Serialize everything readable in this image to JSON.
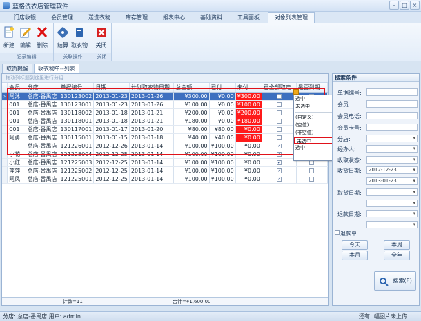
{
  "window": {
    "title": "蓝格洗衣店管理软件"
  },
  "menu_tabs": [
    "门店收银",
    "会员管理",
    "送洗衣物",
    "库存管理",
    "报表中心",
    "基础资料",
    "工具面板",
    "对象列表管理"
  ],
  "ribbon": {
    "groups": [
      {
        "title": "记录编辑",
        "buttons": [
          {
            "label": "新建",
            "icon": "new-doc-icon"
          },
          {
            "label": "编辑",
            "icon": "edit-icon"
          },
          {
            "label": "删除",
            "icon": "delete-x-icon"
          }
        ]
      },
      {
        "title": "关联操作",
        "buttons": [
          {
            "label": "结算",
            "icon": "settle-icon"
          },
          {
            "label": "取衣物",
            "icon": "pickup-icon"
          }
        ]
      },
      {
        "title": "关闭",
        "buttons": [
          {
            "label": "关闭",
            "icon": "close-icon"
          }
        ]
      }
    ]
  },
  "doc_tabs": [
    "取货提醒",
    "收衣物单--列表"
  ],
  "grid": {
    "group_hint": "拖动列标题到这里进行分组",
    "columns": [
      "会员",
      "分店",
      "单据编号",
      "日期",
      "计划取衣物日期",
      "总金额",
      "已付",
      "未付",
      "已全部取走",
      "是否到期"
    ],
    "rows": [
      [
        "阿沐",
        "总店-番禺店",
        "130123002",
        "2013-01-23",
        "2013-01-26",
        "¥300.00",
        "¥0.00",
        "¥300.00",
        false,
        true
      ],
      [
        "001",
        "总店-番禺店",
        "130123001",
        "2013-01-23",
        "2013-01-26",
        "¥100.00",
        "¥0.00",
        "¥100.00",
        false,
        true
      ],
      [
        "001",
        "总店-番禺店",
        "130118002",
        "2013-01-18",
        "2013-01-21",
        "¥200.00",
        "¥0.00",
        "¥200.00",
        false,
        true
      ],
      [
        "001",
        "总店-番禺店",
        "130118001",
        "2013-01-18",
        "2013-01-21",
        "¥180.00",
        "¥0.00",
        "¥180.00",
        false,
        true
      ],
      [
        "001",
        "总店-番禺店",
        "130117001",
        "2013-01-17",
        "2013-01-20",
        "¥80.00",
        "¥80.00",
        "¥0.00",
        false,
        true
      ],
      [
        "阿勇",
        "总店-番禺店",
        "130115001",
        "2013-01-15",
        "2013-01-18",
        "¥40.00",
        "¥40.00",
        "¥0.00",
        false,
        true
      ],
      [
        "",
        "总店-番禺店",
        "121226001",
        "2012-12-26",
        "2013-01-14",
        "¥100.00",
        "¥100.00",
        "¥0.00",
        true,
        false
      ],
      [
        "小花",
        "总店-番禺店",
        "121225004",
        "2012-12-25",
        "2013-01-14",
        "¥100.00",
        "¥100.00",
        "¥0.00",
        true,
        false
      ],
      [
        "小红",
        "总店-番禺店",
        "121225003",
        "2012-12-25",
        "2013-01-14",
        "¥100.00",
        "¥100.00",
        "¥0.00",
        true,
        false
      ],
      [
        "萍萍",
        "总店-番禺店",
        "121225002",
        "2012-12-25",
        "2013-01-14",
        "¥100.00",
        "¥100.00",
        "¥0.00",
        true,
        false
      ],
      [
        "阿凤",
        "总店-番禺店",
        "121225001",
        "2012-12-25",
        "2013-01-14",
        "¥100.00",
        "¥100.00",
        "¥0.00",
        true,
        false
      ]
    ],
    "summary": {
      "count": "计数=11",
      "total": "合计=¥1,600.00"
    }
  },
  "dropdown": {
    "items": [
      "选中",
      "未选中",
      "(自定义)",
      "(空值)",
      "(非空值)",
      "未选中",
      "选中"
    ],
    "highlighted_index": 5
  },
  "search_panel": {
    "title": "搜索条件",
    "fields": [
      "单据编号:",
      "会员:",
      "会员电话:",
      "会员卡号:",
      "分店:",
      "经办人:",
      "收取状态:",
      "收货日期:",
      "取货日期:",
      "退款日期:"
    ],
    "receive_from": "2012-12-23",
    "receive_to": "2013-01-23",
    "refund_label": "退款单",
    "buttons": [
      "今天",
      "本周",
      "本月",
      "全年"
    ],
    "search_label": "搜索(E)"
  },
  "status_bar": {
    "left": "分店: 总店-番禺店  用户: admin",
    "right1": "还有",
    "right2": "幅图片未上传..."
  }
}
